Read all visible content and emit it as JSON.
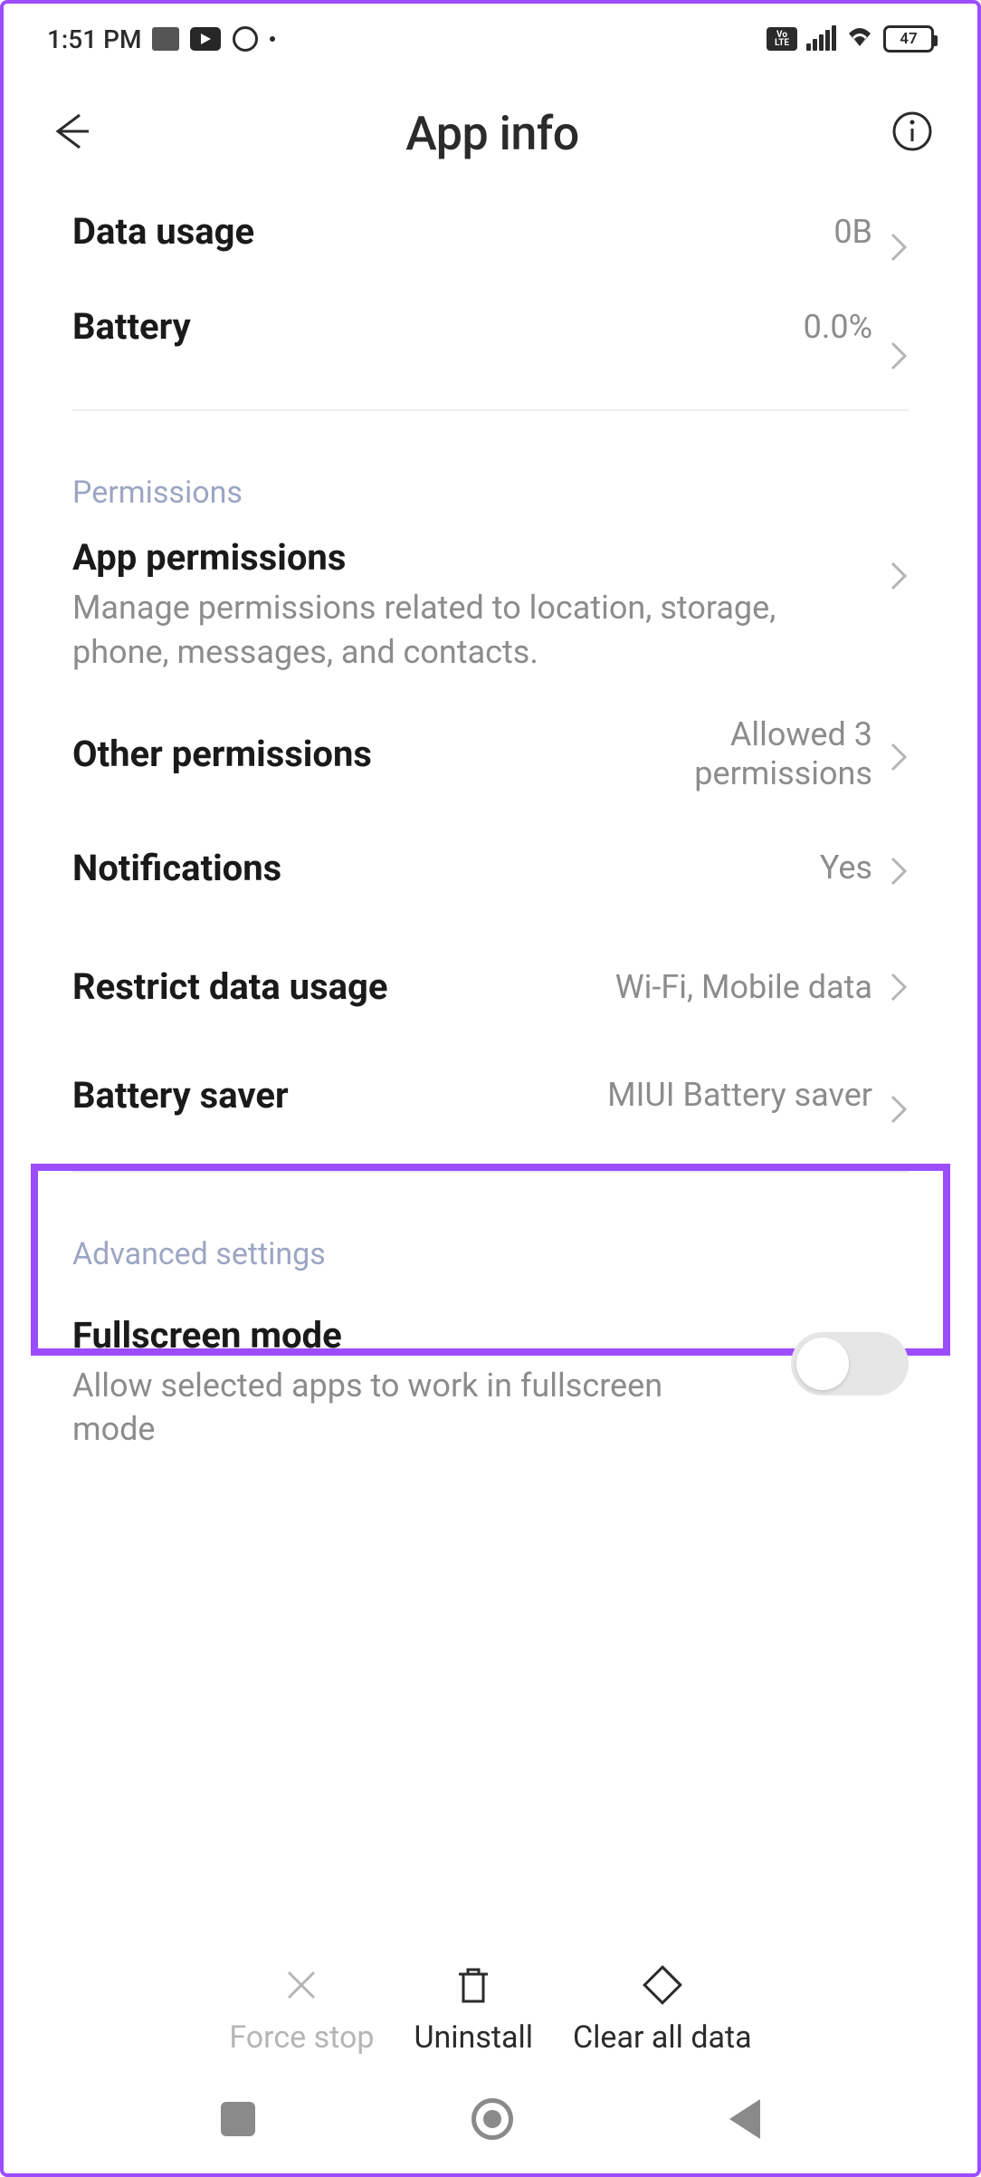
{
  "status": {
    "time": "1:51 PM",
    "battery_level": "47"
  },
  "header": {
    "title": "App info"
  },
  "rows": {
    "data_usage": {
      "label": "Data usage",
      "value": "0B"
    },
    "battery": {
      "label": "Battery",
      "value": "0.0%"
    }
  },
  "sections": {
    "permissions": {
      "title": "Permissions",
      "app_permissions": {
        "label": "App permissions",
        "desc": "Manage permissions related to location, storage, phone, messages, and contacts."
      },
      "other": {
        "label": "Other permissions",
        "value": "Allowed 3 permissions"
      },
      "notifications": {
        "label": "Notifications",
        "value": "Yes"
      },
      "restrict": {
        "label": "Restrict data usage",
        "value": "Wi-Fi, Mobile data"
      },
      "batsaver": {
        "label": "Battery saver",
        "value": "MIUI Battery saver"
      }
    },
    "advanced": {
      "title": "Advanced settings",
      "fullscreen": {
        "label": "Fullscreen mode",
        "desc": "Allow selected apps to work in fullscreen mode",
        "enabled": false
      }
    }
  },
  "actions": {
    "force_stop": "Force stop",
    "uninstall": "Uninstall",
    "clear_data": "Clear all data"
  }
}
